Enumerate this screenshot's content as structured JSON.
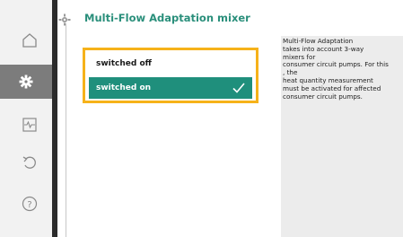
{
  "header": {
    "title": "Multi-Flow Adaptation mixer"
  },
  "rail": {
    "items": [
      {
        "icon": "home-icon"
      },
      {
        "icon": "settings-gear-icon",
        "active": true
      },
      {
        "icon": "diagnostics-icon"
      },
      {
        "icon": "undo-icon"
      },
      {
        "icon": "help-icon"
      }
    ]
  },
  "options": {
    "items": [
      {
        "label": "switched off",
        "selected": false
      },
      {
        "label": "switched on",
        "selected": true
      }
    ]
  },
  "help": {
    "text": "Multi-Flow Adaptation\ntakes into account 3-way\nmixers for\nconsumer circuit pumps. For this\n, the\nheat quantity measurement\nmust be activated for affected\nconsumer circuit pumps."
  },
  "colors": {
    "accent": "#1f8f7c",
    "title": "#2a8f7b",
    "focus": "#f6b21a",
    "rail_active": "#7c7c7c",
    "rail_edge": "#2b2b2b"
  }
}
